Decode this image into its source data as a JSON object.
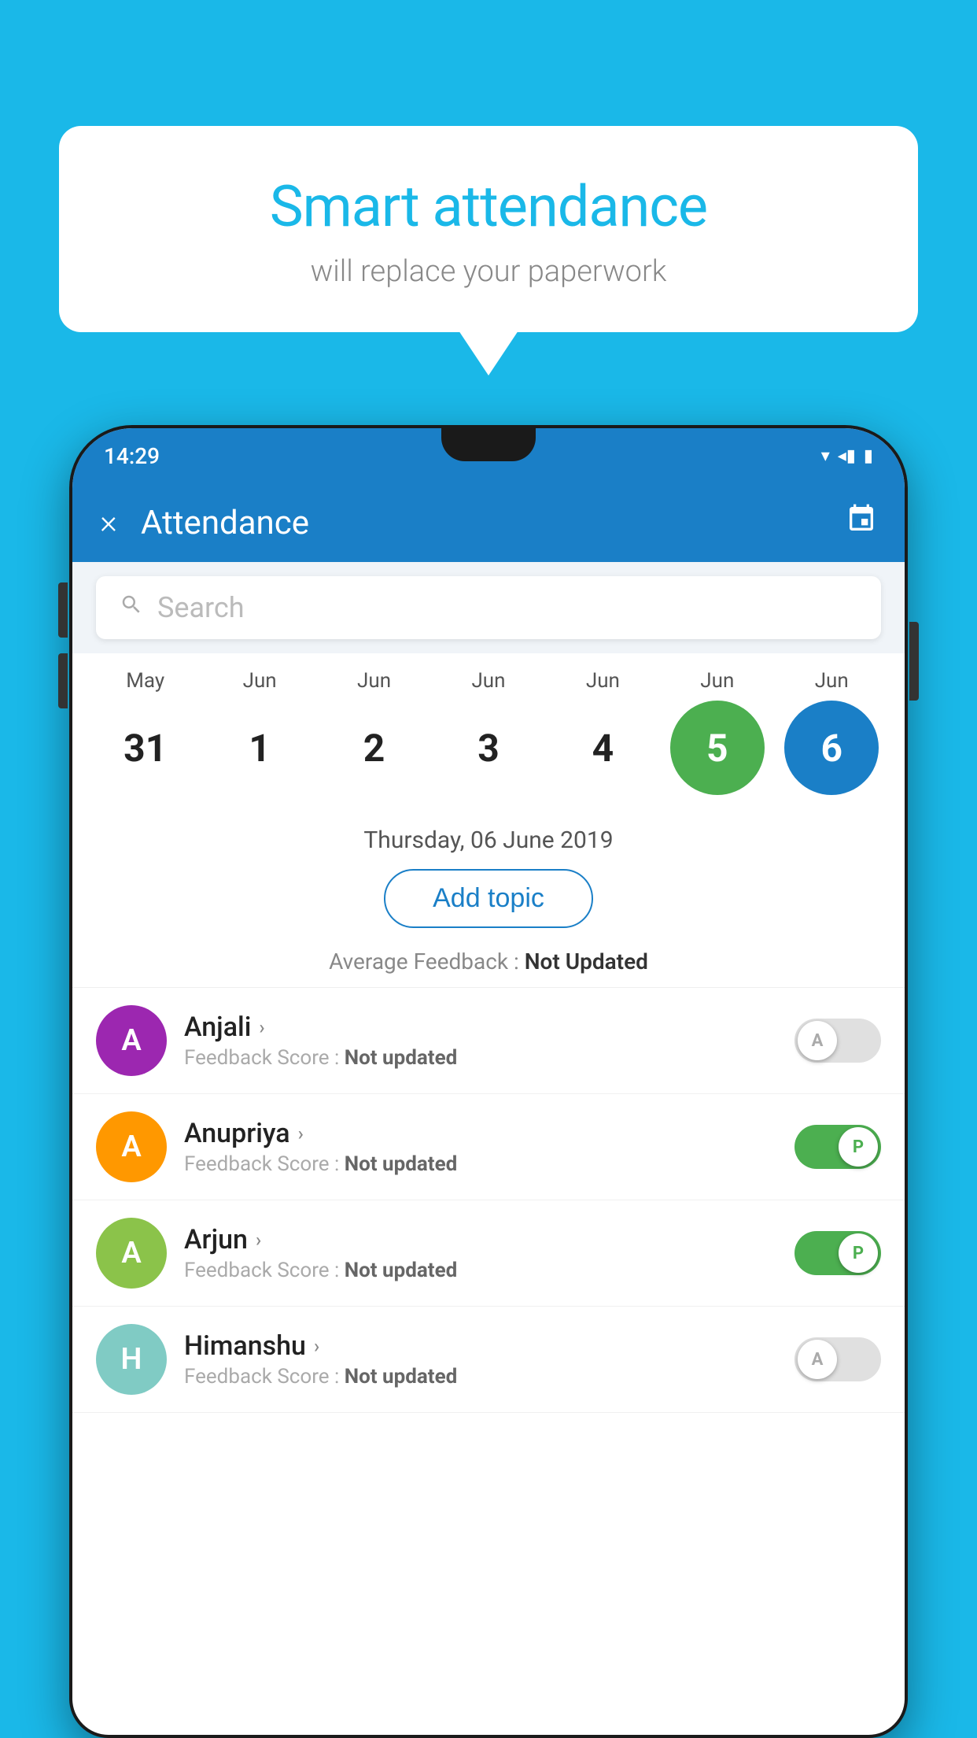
{
  "background_color": "#1ab8e8",
  "bubble": {
    "title": "Smart attendance",
    "subtitle": "will replace your paperwork"
  },
  "status_bar": {
    "time": "14:29",
    "icons": "▾◂▮"
  },
  "app_bar": {
    "title": "Attendance",
    "close_label": "×",
    "calendar_icon": "📅"
  },
  "search": {
    "placeholder": "Search"
  },
  "calendar": {
    "months": [
      "May",
      "Jun",
      "Jun",
      "Jun",
      "Jun",
      "Jun",
      "Jun"
    ],
    "dates": [
      "31",
      "1",
      "2",
      "3",
      "4",
      "5",
      "6"
    ],
    "today_index": 5,
    "selected_index": 6
  },
  "selected_date_label": "Thursday, 06 June 2019",
  "add_topic_label": "Add topic",
  "avg_feedback_prefix": "Average Feedback : ",
  "avg_feedback_value": "Not Updated",
  "students": [
    {
      "name": "Anjali",
      "avatar_letter": "A",
      "avatar_color": "purple",
      "feedback": "Feedback Score : ",
      "feedback_value": "Not updated",
      "status": "absent",
      "toggle_letter": "A"
    },
    {
      "name": "Anupriya",
      "avatar_letter": "A",
      "avatar_color": "orange",
      "feedback": "Feedback Score : ",
      "feedback_value": "Not updated",
      "status": "present",
      "toggle_letter": "P"
    },
    {
      "name": "Arjun",
      "avatar_letter": "A",
      "avatar_color": "lightgreen",
      "feedback": "Feedback Score : ",
      "feedback_value": "Not updated",
      "status": "present",
      "toggle_letter": "P"
    },
    {
      "name": "Himanshu",
      "avatar_letter": "H",
      "avatar_color": "teal",
      "feedback": "Feedback Score : ",
      "feedback_value": "Not updated",
      "status": "absent",
      "toggle_letter": "A"
    }
  ]
}
